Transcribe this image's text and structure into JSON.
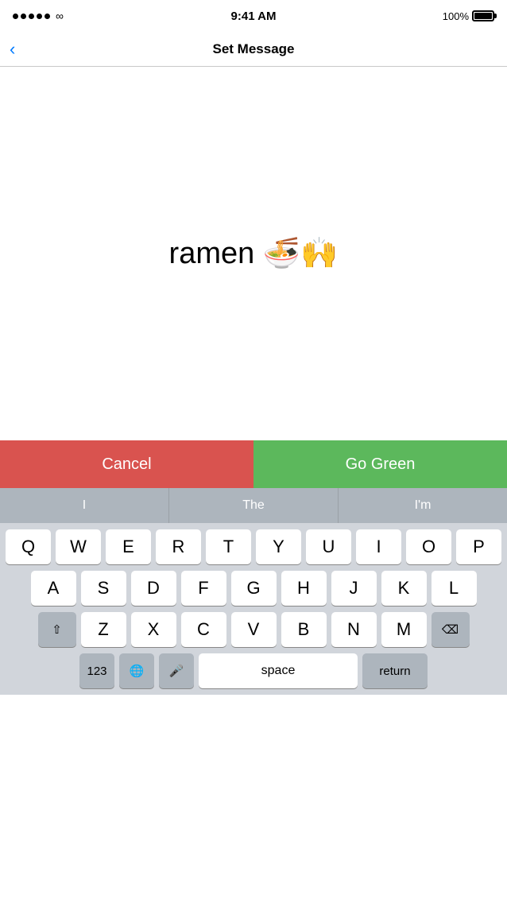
{
  "status_bar": {
    "time": "9:41 AM",
    "battery_percent": "100%"
  },
  "nav": {
    "back_label": "‹",
    "title": "Set Message"
  },
  "message": {
    "text": "ramen 🍜🙌"
  },
  "actions": {
    "cancel_label": "Cancel",
    "go_green_label": "Go Green"
  },
  "autocomplete": {
    "items": [
      "I",
      "The",
      "I'm"
    ]
  },
  "keyboard": {
    "rows": [
      [
        "Q",
        "W",
        "E",
        "R",
        "T",
        "Y",
        "U",
        "I",
        "O",
        "P"
      ],
      [
        "A",
        "S",
        "D",
        "F",
        "G",
        "H",
        "J",
        "K",
        "L"
      ],
      [
        "Z",
        "X",
        "C",
        "V",
        "B",
        "N",
        "M"
      ]
    ],
    "bottom": {
      "num_label": "123",
      "space_label": "space",
      "return_label": "return"
    }
  },
  "colors": {
    "cancel": "#d9534f",
    "go_green": "#5cb85c",
    "autocomplete_bg": "#adb5bd",
    "keyboard_bg": "#d1d5db"
  }
}
